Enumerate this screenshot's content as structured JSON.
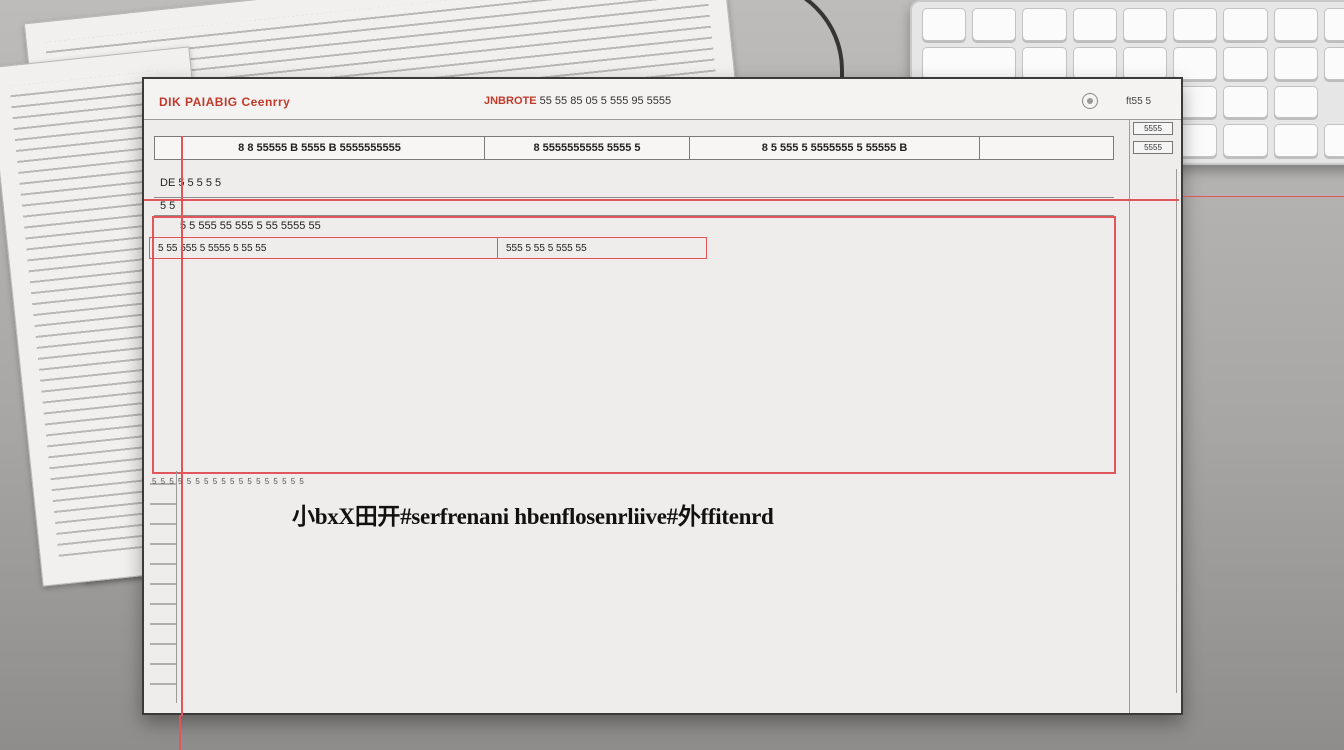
{
  "window": {
    "title": "DIK PAIABIG Ceenrry",
    "subtitle_prefix": "JNBROTE",
    "subtitle_rest": "55 55 85 05 5 555 95 5555",
    "title_right": "ft55 5"
  },
  "tabs": [
    {
      "label": "8 8 55555 B 5555 B 5555555555"
    },
    {
      "label": "8 5555555555 5555 5"
    },
    {
      "label": "8 5 555 5 5555555 5 55555 B"
    },
    {
      "label": ""
    }
  ],
  "side_buttons": [
    {
      "label": "5555"
    },
    {
      "label": "5555"
    }
  ],
  "rows": {
    "row1_label": "DE 5 5 5 5 5",
    "row2_label": "5 5",
    "row3_text": "5 5 555 55 555 5 55 5555 55",
    "filter_cell1": "5 55 555 5 5555 5 55 55",
    "filter_cell2": "555 5 55 5 555        55"
  },
  "footer": {
    "dotted": "5 5 5 5 5 5 5 5 5 5 5 5 5 5 5 5 5 5",
    "caption": "小bxX田开#serfrenani hbenflosenrliive#外ffitenrd"
  }
}
